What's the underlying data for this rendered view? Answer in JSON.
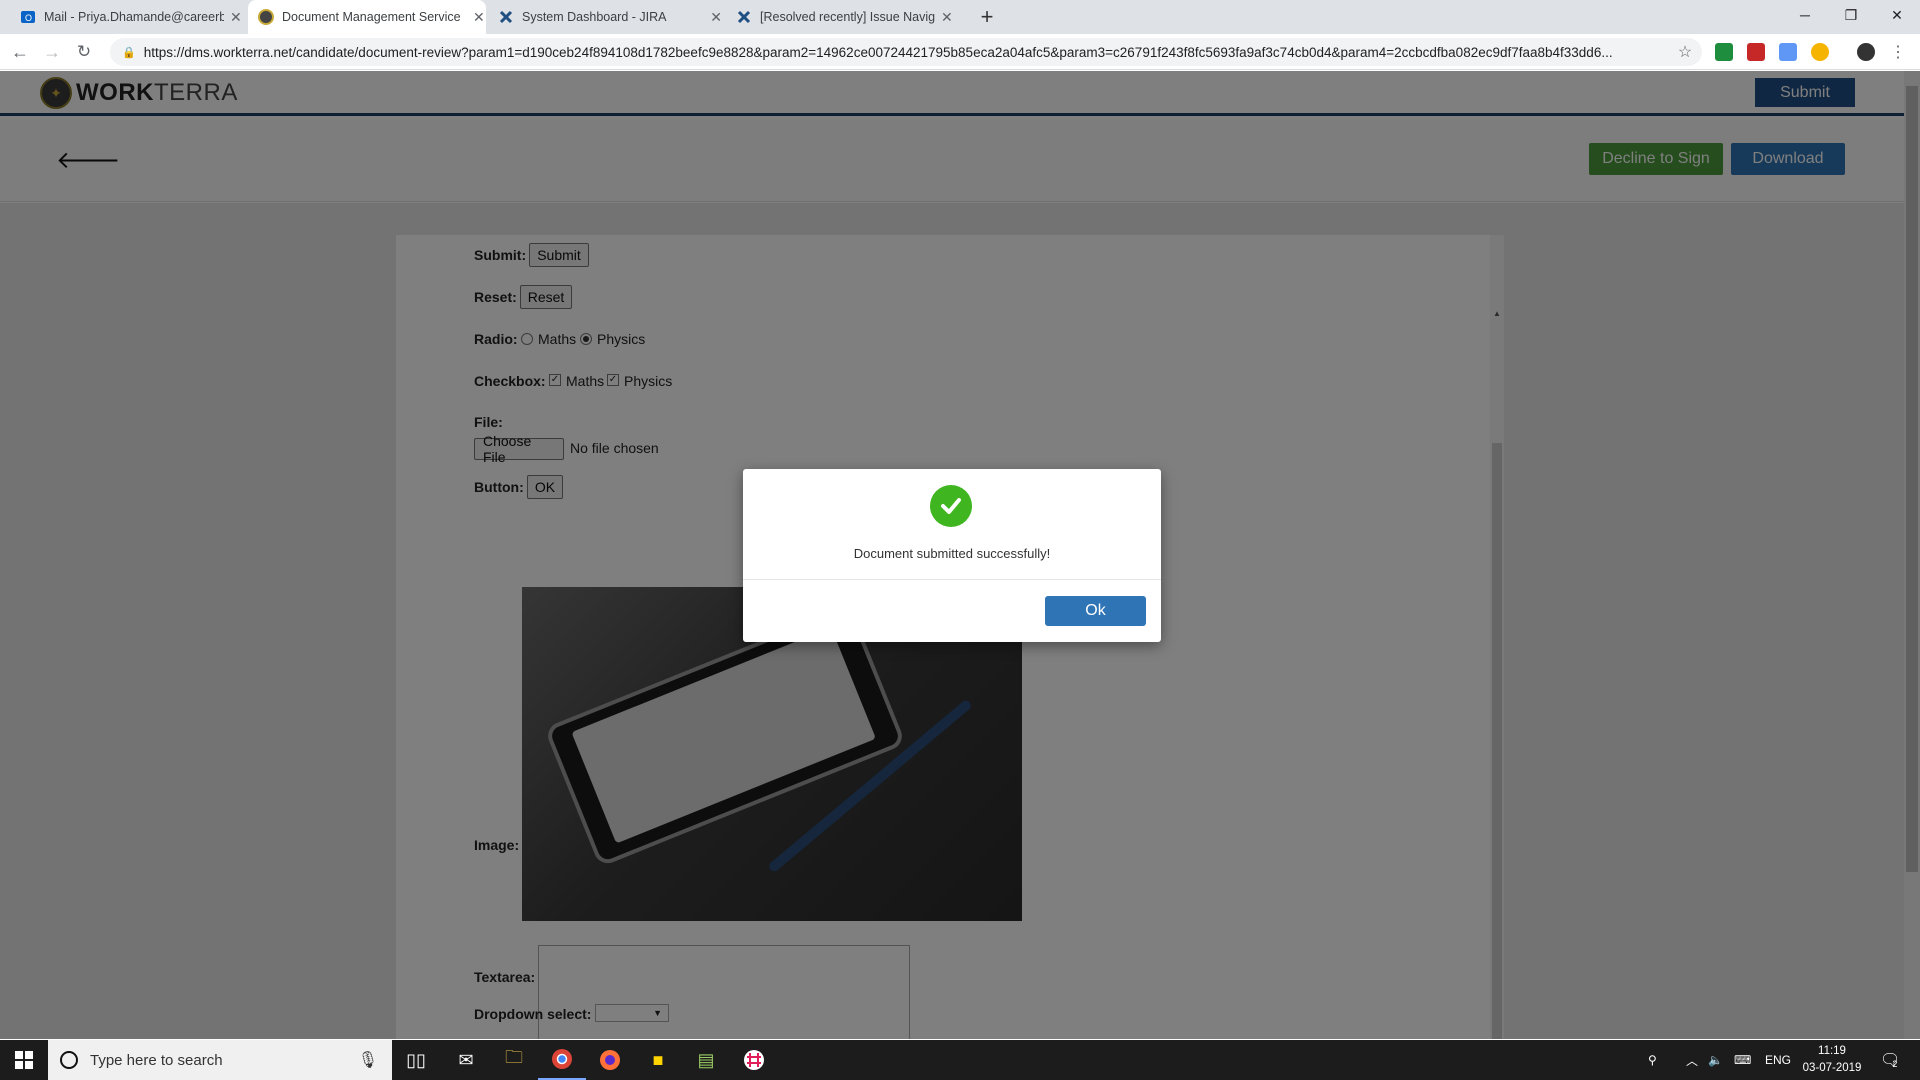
{
  "browser": {
    "tabs": [
      {
        "title": "Mail - Priya.Dhamande@careerb",
        "icon": "outlook-icon",
        "active": false
      },
      {
        "title": "Document Management Service",
        "icon": "workterra-icon",
        "active": true
      },
      {
        "title": "System Dashboard - JIRA",
        "icon": "jira-icon",
        "active": false
      },
      {
        "title": "[Resolved recently] Issue Navigat",
        "icon": "jira-icon",
        "active": false
      }
    ],
    "url": "https://dms.workterra.net/candidate/document-review?param1=d190ceb24f894108d1782beefc9e8828&param2=14962ce00724421795b85eca2a04afc5&param3=c26791f243f8fc5693fa9af3c74cb0d4&param4=2ccbcdfba082ec9df7faa8b4f33dd6..."
  },
  "app": {
    "logo_bold": "WORK",
    "logo_light": "TERRA",
    "header_submit": "Submit",
    "decline_label": "Decline to Sign",
    "download_label": "Download"
  },
  "form": {
    "submit_label": "Submit:",
    "submit_button": "Submit",
    "reset_label": "Reset:",
    "reset_button": "Reset",
    "radio_label": "Radio:",
    "radio_options": [
      {
        "label": "Maths",
        "checked": false
      },
      {
        "label": "Physics",
        "checked": true
      }
    ],
    "checkbox_label": "Checkbox:",
    "checkbox_options": [
      {
        "label": "Maths",
        "checked": true
      },
      {
        "label": "Physics",
        "checked": true
      }
    ],
    "file_label": "File:",
    "file_button": "Choose File",
    "file_status": "No file chosen",
    "button_label": "Button:",
    "button_text": "OK",
    "image_label": "Image:",
    "textarea_label": "Textarea:",
    "textarea_value": "",
    "dropdown_label": "Dropdown select:",
    "dropdown_value": ""
  },
  "modal": {
    "message": "Document submitted successfully!",
    "ok_label": "Ok"
  },
  "taskbar": {
    "search_placeholder": "Type here to search",
    "language": "ENG",
    "time": "11:19",
    "date": "03-07-2019",
    "notification_count": "2"
  },
  "colors": {
    "brand_blue": "#1f4e85",
    "decline_green": "#4a9a3a",
    "download_blue": "#2f74b5",
    "success_green": "#3fb51f"
  }
}
